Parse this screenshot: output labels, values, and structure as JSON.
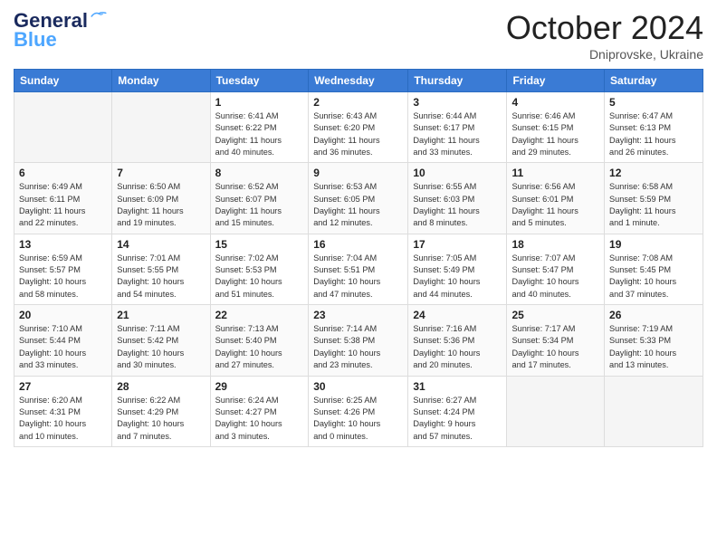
{
  "header": {
    "logo_line1": "General",
    "logo_line2": "Blue",
    "month": "October 2024",
    "location": "Dniprovske, Ukraine"
  },
  "weekdays": [
    "Sunday",
    "Monday",
    "Tuesday",
    "Wednesday",
    "Thursday",
    "Friday",
    "Saturday"
  ],
  "weeks": [
    [
      {
        "day": "",
        "info": ""
      },
      {
        "day": "",
        "info": ""
      },
      {
        "day": "1",
        "info": "Sunrise: 6:41 AM\nSunset: 6:22 PM\nDaylight: 11 hours\nand 40 minutes."
      },
      {
        "day": "2",
        "info": "Sunrise: 6:43 AM\nSunset: 6:20 PM\nDaylight: 11 hours\nand 36 minutes."
      },
      {
        "day": "3",
        "info": "Sunrise: 6:44 AM\nSunset: 6:17 PM\nDaylight: 11 hours\nand 33 minutes."
      },
      {
        "day": "4",
        "info": "Sunrise: 6:46 AM\nSunset: 6:15 PM\nDaylight: 11 hours\nand 29 minutes."
      },
      {
        "day": "5",
        "info": "Sunrise: 6:47 AM\nSunset: 6:13 PM\nDaylight: 11 hours\nand 26 minutes."
      }
    ],
    [
      {
        "day": "6",
        "info": "Sunrise: 6:49 AM\nSunset: 6:11 PM\nDaylight: 11 hours\nand 22 minutes."
      },
      {
        "day": "7",
        "info": "Sunrise: 6:50 AM\nSunset: 6:09 PM\nDaylight: 11 hours\nand 19 minutes."
      },
      {
        "day": "8",
        "info": "Sunrise: 6:52 AM\nSunset: 6:07 PM\nDaylight: 11 hours\nand 15 minutes."
      },
      {
        "day": "9",
        "info": "Sunrise: 6:53 AM\nSunset: 6:05 PM\nDaylight: 11 hours\nand 12 minutes."
      },
      {
        "day": "10",
        "info": "Sunrise: 6:55 AM\nSunset: 6:03 PM\nDaylight: 11 hours\nand 8 minutes."
      },
      {
        "day": "11",
        "info": "Sunrise: 6:56 AM\nSunset: 6:01 PM\nDaylight: 11 hours\nand 5 minutes."
      },
      {
        "day": "12",
        "info": "Sunrise: 6:58 AM\nSunset: 5:59 PM\nDaylight: 11 hours\nand 1 minute."
      }
    ],
    [
      {
        "day": "13",
        "info": "Sunrise: 6:59 AM\nSunset: 5:57 PM\nDaylight: 10 hours\nand 58 minutes."
      },
      {
        "day": "14",
        "info": "Sunrise: 7:01 AM\nSunset: 5:55 PM\nDaylight: 10 hours\nand 54 minutes."
      },
      {
        "day": "15",
        "info": "Sunrise: 7:02 AM\nSunset: 5:53 PM\nDaylight: 10 hours\nand 51 minutes."
      },
      {
        "day": "16",
        "info": "Sunrise: 7:04 AM\nSunset: 5:51 PM\nDaylight: 10 hours\nand 47 minutes."
      },
      {
        "day": "17",
        "info": "Sunrise: 7:05 AM\nSunset: 5:49 PM\nDaylight: 10 hours\nand 44 minutes."
      },
      {
        "day": "18",
        "info": "Sunrise: 7:07 AM\nSunset: 5:47 PM\nDaylight: 10 hours\nand 40 minutes."
      },
      {
        "day": "19",
        "info": "Sunrise: 7:08 AM\nSunset: 5:45 PM\nDaylight: 10 hours\nand 37 minutes."
      }
    ],
    [
      {
        "day": "20",
        "info": "Sunrise: 7:10 AM\nSunset: 5:44 PM\nDaylight: 10 hours\nand 33 minutes."
      },
      {
        "day": "21",
        "info": "Sunrise: 7:11 AM\nSunset: 5:42 PM\nDaylight: 10 hours\nand 30 minutes."
      },
      {
        "day": "22",
        "info": "Sunrise: 7:13 AM\nSunset: 5:40 PM\nDaylight: 10 hours\nand 27 minutes."
      },
      {
        "day": "23",
        "info": "Sunrise: 7:14 AM\nSunset: 5:38 PM\nDaylight: 10 hours\nand 23 minutes."
      },
      {
        "day": "24",
        "info": "Sunrise: 7:16 AM\nSunset: 5:36 PM\nDaylight: 10 hours\nand 20 minutes."
      },
      {
        "day": "25",
        "info": "Sunrise: 7:17 AM\nSunset: 5:34 PM\nDaylight: 10 hours\nand 17 minutes."
      },
      {
        "day": "26",
        "info": "Sunrise: 7:19 AM\nSunset: 5:33 PM\nDaylight: 10 hours\nand 13 minutes."
      }
    ],
    [
      {
        "day": "27",
        "info": "Sunrise: 6:20 AM\nSunset: 4:31 PM\nDaylight: 10 hours\nand 10 minutes."
      },
      {
        "day": "28",
        "info": "Sunrise: 6:22 AM\nSunset: 4:29 PM\nDaylight: 10 hours\nand 7 minutes."
      },
      {
        "day": "29",
        "info": "Sunrise: 6:24 AM\nSunset: 4:27 PM\nDaylight: 10 hours\nand 3 minutes."
      },
      {
        "day": "30",
        "info": "Sunrise: 6:25 AM\nSunset: 4:26 PM\nDaylight: 10 hours\nand 0 minutes."
      },
      {
        "day": "31",
        "info": "Sunrise: 6:27 AM\nSunset: 4:24 PM\nDaylight: 9 hours\nand 57 minutes."
      },
      {
        "day": "",
        "info": ""
      },
      {
        "day": "",
        "info": ""
      }
    ]
  ]
}
